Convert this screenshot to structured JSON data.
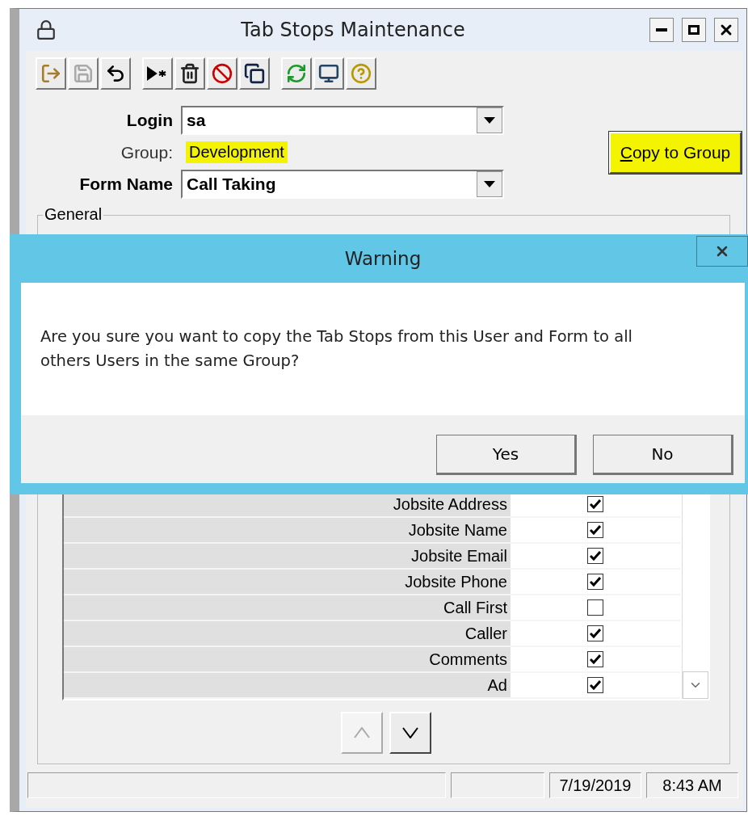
{
  "window": {
    "title": "Tab Stops Maintenance"
  },
  "toolbar_groups": [
    [
      {
        "kind": "exit",
        "disabled": false
      },
      {
        "kind": "save",
        "disabled": true
      },
      {
        "kind": "undo",
        "disabled": false
      }
    ],
    [
      {
        "kind": "new",
        "disabled": false
      },
      {
        "kind": "delete",
        "disabled": false
      },
      {
        "kind": "cancel",
        "disabled": false
      },
      {
        "kind": "copy",
        "disabled": false
      }
    ],
    [
      {
        "kind": "refresh",
        "disabled": false
      },
      {
        "kind": "monitor",
        "disabled": false
      },
      {
        "kind": "help",
        "disabled": false
      }
    ]
  ],
  "login": {
    "label": "Login",
    "value": "sa"
  },
  "group": {
    "label": "Group:",
    "value": "Development",
    "highlighted": true
  },
  "form_name": {
    "label": "Form Name",
    "value": "Call Taking"
  },
  "copy_button": {
    "label": "Copy to Group",
    "first_letter_underlined": true,
    "highlighted": true
  },
  "group_box": {
    "title": "General"
  },
  "rows": [
    {
      "label": "Jobsite Address",
      "checked": true
    },
    {
      "label": "Jobsite Name",
      "checked": true
    },
    {
      "label": "Jobsite Email",
      "checked": true
    },
    {
      "label": "Jobsite Phone",
      "checked": true
    },
    {
      "label": "Call First",
      "checked": false
    },
    {
      "label": "Caller",
      "checked": true
    },
    {
      "label": "Comments",
      "checked": true
    },
    {
      "label": "Ad",
      "checked": true
    }
  ],
  "move_buttons": [
    {
      "kind": "up",
      "disabled": true
    },
    {
      "kind": "down",
      "disabled": false
    }
  ],
  "status_bar": {
    "date": "7/19/2019",
    "time": "8:43 AM"
  },
  "dialog": {
    "title": "Warning",
    "message": "Are you sure you want to copy the Tab Stops from this User and Form to all others Users in the same Group?",
    "buttons": [
      "Yes",
      "No"
    ]
  }
}
